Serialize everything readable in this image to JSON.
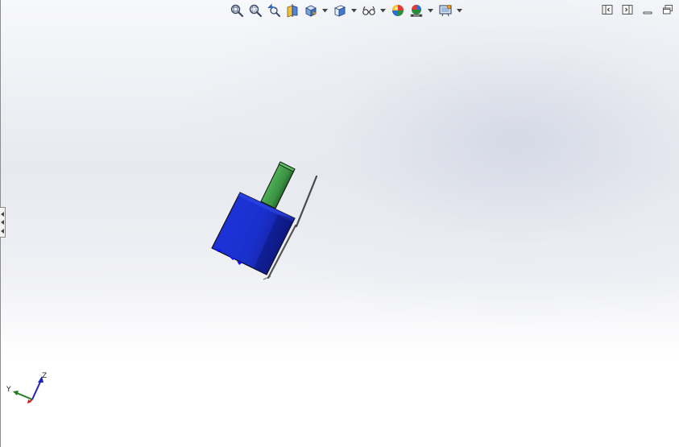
{
  "toolbar": {
    "items": [
      {
        "icon": "zoom-to-fit-icon"
      },
      {
        "icon": "zoom-to-area-icon"
      },
      {
        "icon": "previous-view-icon"
      },
      {
        "icon": "section-view-icon"
      },
      {
        "icon": "view-orientation-icon",
        "dropdown": true
      },
      {
        "icon": "display-style-icon",
        "dropdown": true
      },
      {
        "icon": "hide-show-items-icon",
        "dropdown": true
      },
      {
        "icon": "edit-appearance-icon"
      },
      {
        "icon": "apply-scene-icon",
        "dropdown": true
      },
      {
        "icon": "view-settings-icon",
        "dropdown": true
      }
    ]
  },
  "window_controls": [
    "tile-horizontal-icon",
    "tile-vertical-icon",
    "minimize-icon",
    "restore-icon"
  ],
  "triad": {
    "y_label": "Y",
    "z_label": "Z"
  },
  "colors": {
    "body_blue": "#1b2fd0",
    "body_blue_dark": "#0a1478",
    "shaft_green": "#3f9a46",
    "axis_y_green": "#1f7a1f",
    "axis_z_blue": "#2222b8",
    "axis_x_red": "#c81e1e"
  }
}
